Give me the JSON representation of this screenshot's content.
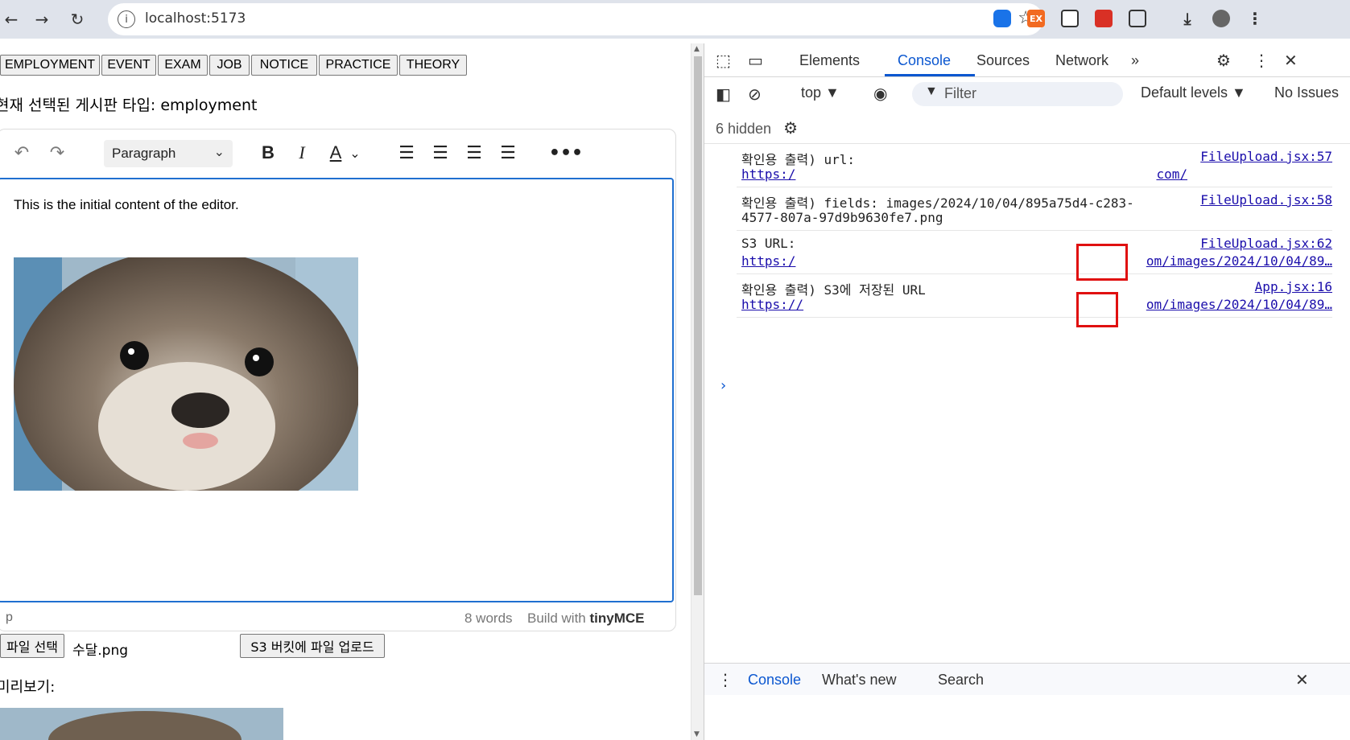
{
  "browser": {
    "url": "localhost:5173",
    "back_icon": "←",
    "forward_icon": "→",
    "reload_icon": "↻",
    "info_icon": "i",
    "star_icon": "☆",
    "ext_labels": [
      "EX"
    ]
  },
  "page": {
    "board_types": [
      "EMPLOYMENT",
      "EVENT",
      "EXAM",
      "JOB",
      "NOTICE",
      "PRACTICE",
      "THEORY"
    ],
    "current_type_text": "현재 선택된 게시판 타입: employment",
    "editor": {
      "format_select": "Paragraph",
      "content_text": "This is the initial content of the editor.",
      "status_path": "p",
      "word_count": "8 words",
      "brand_prefix": "Build with",
      "brand_name": "tinyMCE"
    },
    "file_select_label": "파일 선택",
    "file_name": "수달.png",
    "upload_label": "S3 버킷에 파일 업로드",
    "preview_label": "미리보기:"
  },
  "devtools": {
    "tabs": [
      "Elements",
      "Console",
      "Sources",
      "Network"
    ],
    "active_tab": "Console",
    "more_tabs": "»",
    "context": "top ▼",
    "filter_placeholder": "Filter",
    "levels": "Default levels ▼",
    "issues": "No Issues",
    "hidden": "6 hidden",
    "logs": [
      {
        "line1": "확인용 출력) url:",
        "link": "https:/",
        "tail": "com/",
        "source": "FileUpload.jsx:57"
      },
      {
        "line1": "확인용 출력) fields:  images/2024/10/04/895a75d4-c283-",
        "line2": "4577-807a-97d9b9630fe7.png",
        "source": "FileUpload.jsx:58"
      },
      {
        "line1": "S3 URL:",
        "link": "https:/",
        "tail": "om/images/2024/10/04/89…",
        "source": "FileUpload.jsx:62"
      },
      {
        "line1": "확인용 출력) S3에 저장된 URL",
        "link": "https://",
        "tail": "om/images/2024/10/04/89…",
        "source": "App.jsx:16"
      }
    ],
    "prompt": "›",
    "drawer_tabs": [
      "Console",
      "What's new",
      "Search"
    ]
  }
}
